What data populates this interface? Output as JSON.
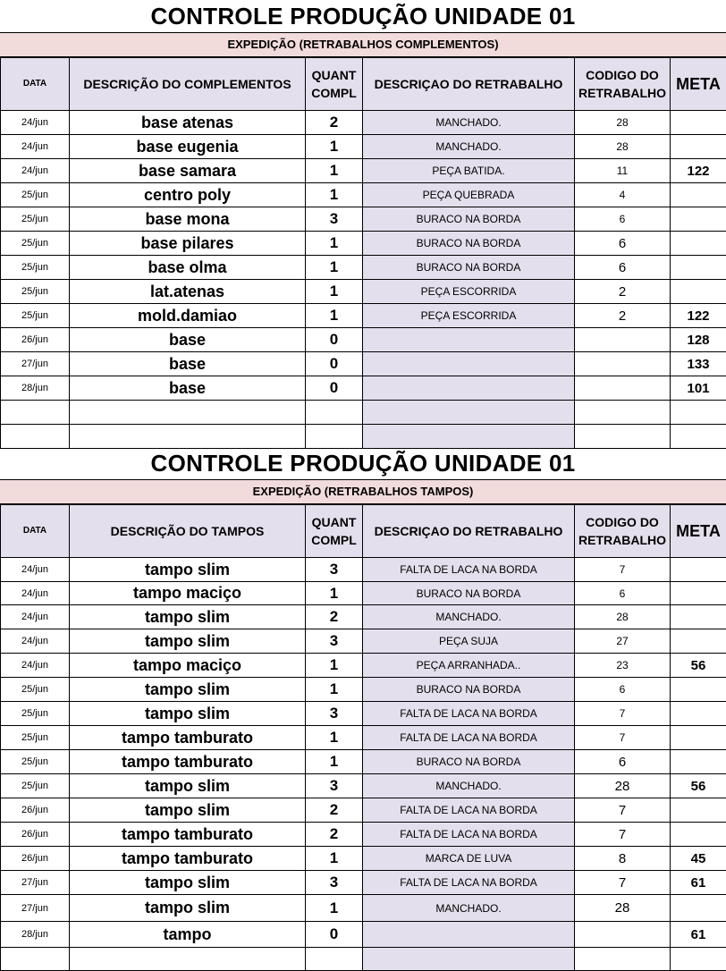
{
  "headers": {
    "date": "DATA",
    "qty": "QUANT COMPL",
    "rework": "DESCRIÇAO DO RETRABALHO",
    "code": "CODIGO DO RETRABALHO",
    "meta": "META"
  },
  "section1": {
    "title": "CONTROLE PRODUÇÃO UNIDADE 01",
    "subtitle": "EXPEDIÇÃO (RETRABALHOS COMPLEMENTOS)",
    "desc_header": "DESCRIÇÃO DO COMPLEMENTOS",
    "rows": [
      {
        "date": "24/jun",
        "desc": "base atenas",
        "qty": "2",
        "rework": "MANCHADO.",
        "code": "28",
        "meta": ""
      },
      {
        "date": "24/jun",
        "desc": "base eugenia",
        "qty": "1",
        "rework": "MANCHADO.",
        "code": "28",
        "meta": ""
      },
      {
        "date": "24/jun",
        "desc": "base samara",
        "qty": "1",
        "rework": "PEÇA BATIDA.",
        "code": "11",
        "meta": "122"
      },
      {
        "date": "25/jun",
        "desc": "centro poly",
        "qty": "1",
        "rework": "PEÇA QUEBRADA",
        "code": "4",
        "meta": ""
      },
      {
        "date": "25/jun",
        "desc": "base mona",
        "qty": "3",
        "rework": "BURACO NA BORDA",
        "code": "6",
        "meta": ""
      },
      {
        "date": "25/jun",
        "desc": "base pilares",
        "qty": "1",
        "rework": "BURACO NA BORDA",
        "code": "6",
        "meta": ""
      },
      {
        "date": "25/jun",
        "desc": "base olma",
        "qty": "1",
        "rework": "BURACO NA BORDA",
        "code": "6",
        "meta": ""
      },
      {
        "date": "25/jun",
        "desc": "lat.atenas",
        "qty": "1",
        "rework": "PEÇA ESCORRIDA",
        "code": "2",
        "meta": ""
      },
      {
        "date": "25/jun",
        "desc": "mold.damiao",
        "qty": "1",
        "rework": "PEÇA ESCORRIDA",
        "code": "2",
        "meta": "122"
      },
      {
        "date": "26/jun",
        "desc": "base",
        "qty": "0",
        "rework": "",
        "code": "",
        "meta": "128"
      },
      {
        "date": "27/jun",
        "desc": "base",
        "qty": "0",
        "rework": "",
        "code": "",
        "meta": "133"
      },
      {
        "date": "28/jun",
        "desc": "base",
        "qty": "0",
        "rework": "",
        "code": "",
        "meta": "101"
      },
      {
        "date": "",
        "desc": "",
        "qty": "",
        "rework": "",
        "code": "",
        "meta": ""
      },
      {
        "date": "",
        "desc": "",
        "qty": "",
        "rework": "",
        "code": "",
        "meta": ""
      }
    ]
  },
  "section2": {
    "title": "CONTROLE PRODUÇÃO UNIDADE 01",
    "subtitle": "EXPEDIÇÃO (RETRABALHOS TAMPOS)",
    "desc_header": "DESCRIÇÃO DO TAMPOS",
    "rows": [
      {
        "date": "24/jun",
        "desc": "tampo slim",
        "qty": "3",
        "rework": "FALTA DE LACA NA BORDA",
        "code": "7",
        "meta": ""
      },
      {
        "date": "24/jun",
        "desc": "tampo maciço",
        "qty": "1",
        "rework": "BURACO NA BORDA",
        "code": "6",
        "meta": ""
      },
      {
        "date": "24/jun",
        "desc": "tampo slim",
        "qty": "2",
        "rework": "MANCHADO.",
        "code": "28",
        "meta": ""
      },
      {
        "date": "24/jun",
        "desc": "tampo slim",
        "qty": "3",
        "rework": "PEÇA SUJA",
        "code": "27",
        "meta": ""
      },
      {
        "date": "24/jun",
        "desc": "tampo maciço",
        "qty": "1",
        "rework": "PEÇA ARRANHADA..",
        "code": "23",
        "meta": "56"
      },
      {
        "date": "25/jun",
        "desc": "tampo slim",
        "qty": "1",
        "rework": "BURACO NA BORDA",
        "code": "6",
        "meta": ""
      },
      {
        "date": "25/jun",
        "desc": "tampo slim",
        "qty": "3",
        "rework": "FALTA DE LACA NA BORDA",
        "code": "7",
        "meta": ""
      },
      {
        "date": "25/jun",
        "desc": "tampo tamburato",
        "qty": "1",
        "rework": "FALTA DE LACA NA BORDA",
        "code": "7",
        "meta": ""
      },
      {
        "date": "25/jun",
        "desc": "tampo tamburato",
        "qty": "1",
        "rework": "BURACO NA BORDA",
        "code": "6",
        "meta": ""
      },
      {
        "date": "25/jun",
        "desc": "tampo slim",
        "qty": "3",
        "rework": "MANCHADO.",
        "code": "28",
        "meta": "56"
      },
      {
        "date": "26/jun",
        "desc": "tampo slim",
        "qty": "2",
        "rework": "FALTA DE LACA NA BORDA",
        "code": "7",
        "meta": ""
      },
      {
        "date": "26/jun",
        "desc": "tampo tamburato",
        "qty": "2",
        "rework": "FALTA DE LACA NA BORDA",
        "code": "7",
        "meta": ""
      },
      {
        "date": "26/jun",
        "desc": "tampo tamburato",
        "qty": "1",
        "rework": "MARCA DE LUVA",
        "code": "8",
        "meta": "45"
      },
      {
        "date": "27/jun",
        "desc": "tampo slim",
        "qty": "3",
        "rework": "FALTA DE LACA NA BORDA",
        "code": "7",
        "meta": "61"
      },
      {
        "date": "27/jun",
        "desc": "tampo slim",
        "qty": "1",
        "rework": "MANCHADO.",
        "code": "28",
        "meta": ""
      },
      {
        "date": "28/jun",
        "desc": "tampo",
        "qty": "0",
        "rework": "",
        "code": "",
        "meta": "61"
      },
      {
        "date": "",
        "desc": "",
        "qty": "",
        "rework": "",
        "code": "",
        "meta": ""
      }
    ]
  }
}
